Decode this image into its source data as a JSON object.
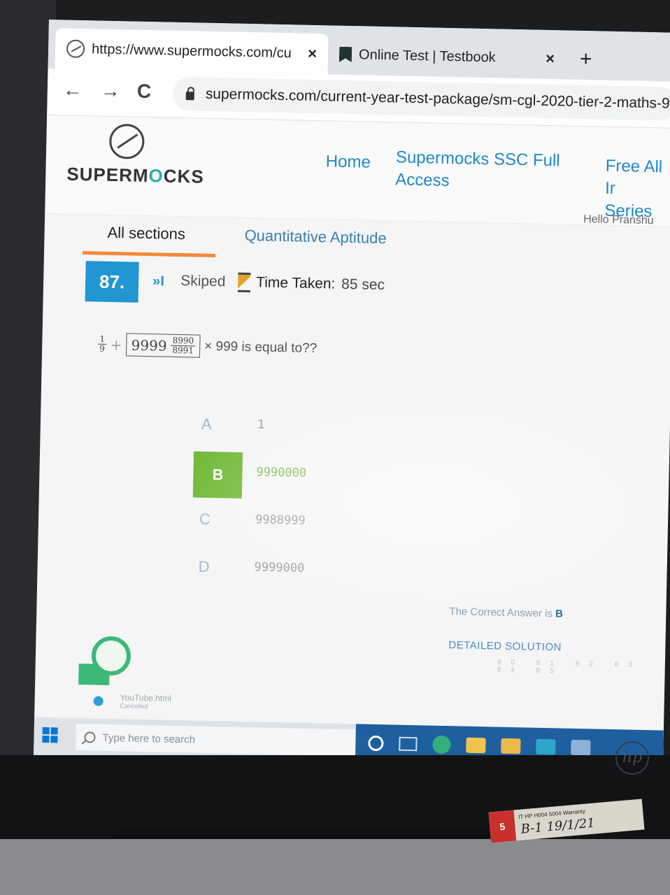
{
  "browser": {
    "tabs": [
      {
        "title": "https://www.supermocks.com/cu",
        "close": "×",
        "icon": "supermocks-logo-icon"
      },
      {
        "title": "Online Test | Testbook",
        "close": "×",
        "icon": "testbook-icon"
      }
    ],
    "new_tab": "+",
    "nav": {
      "back": "←",
      "forward": "→",
      "reload": "C"
    },
    "url": "supermocks.com/current-year-test-package/sm-cgl-2020-tier-2-maths-9-"
  },
  "site": {
    "brand_start": "SUPERM",
    "brand_accent": "O",
    "brand_end": "CKS",
    "accent_color": "#2bb0a5",
    "nav": [
      {
        "line1": "Home",
        "line2": ""
      },
      {
        "line1": "Supermocks SSC Full",
        "line2": "Access"
      },
      {
        "line1": "Free All Ir",
        "line2": "Series"
      }
    ],
    "greeting": "Hello Pranshu"
  },
  "sections": {
    "active": "All sections",
    "other": "Quantitative Aptitude",
    "underline_color": "#f08a3c"
  },
  "question": {
    "number": "87.",
    "status_icon": "»I",
    "status": "Skiped",
    "time_label": "Time Taken:",
    "time_value": "85 sec",
    "frac1_num": "1",
    "frac1_den": "9",
    "plus": "+",
    "int_part": "9999",
    "frac2_num": "8990",
    "frac2_den": "8991",
    "tail": "× 999 is equal to??"
  },
  "options": [
    {
      "letter": "A",
      "value": "1",
      "correct": false
    },
    {
      "letter": "B",
      "value": "9990000",
      "correct": true
    },
    {
      "letter": "C",
      "value": "9988999",
      "correct": false
    },
    {
      "letter": "D",
      "value": "9999000",
      "correct": false
    }
  ],
  "answer": {
    "label": "The Correct Answer is",
    "value": "B",
    "solution_link": "DETAILED SOLUTION",
    "pager": "80 81 82 83 84 85"
  },
  "download": {
    "name": "YouTube.html",
    "status": "Cancelled"
  },
  "taskbar": {
    "search_placeholder": "Type here to search"
  },
  "hardware": {
    "hp_logo": "hp",
    "sticker_brand": "5",
    "sticker_line": "IT HP H004 5004 Warranty",
    "sticker_handwriting": "B-1 19/1/21"
  }
}
